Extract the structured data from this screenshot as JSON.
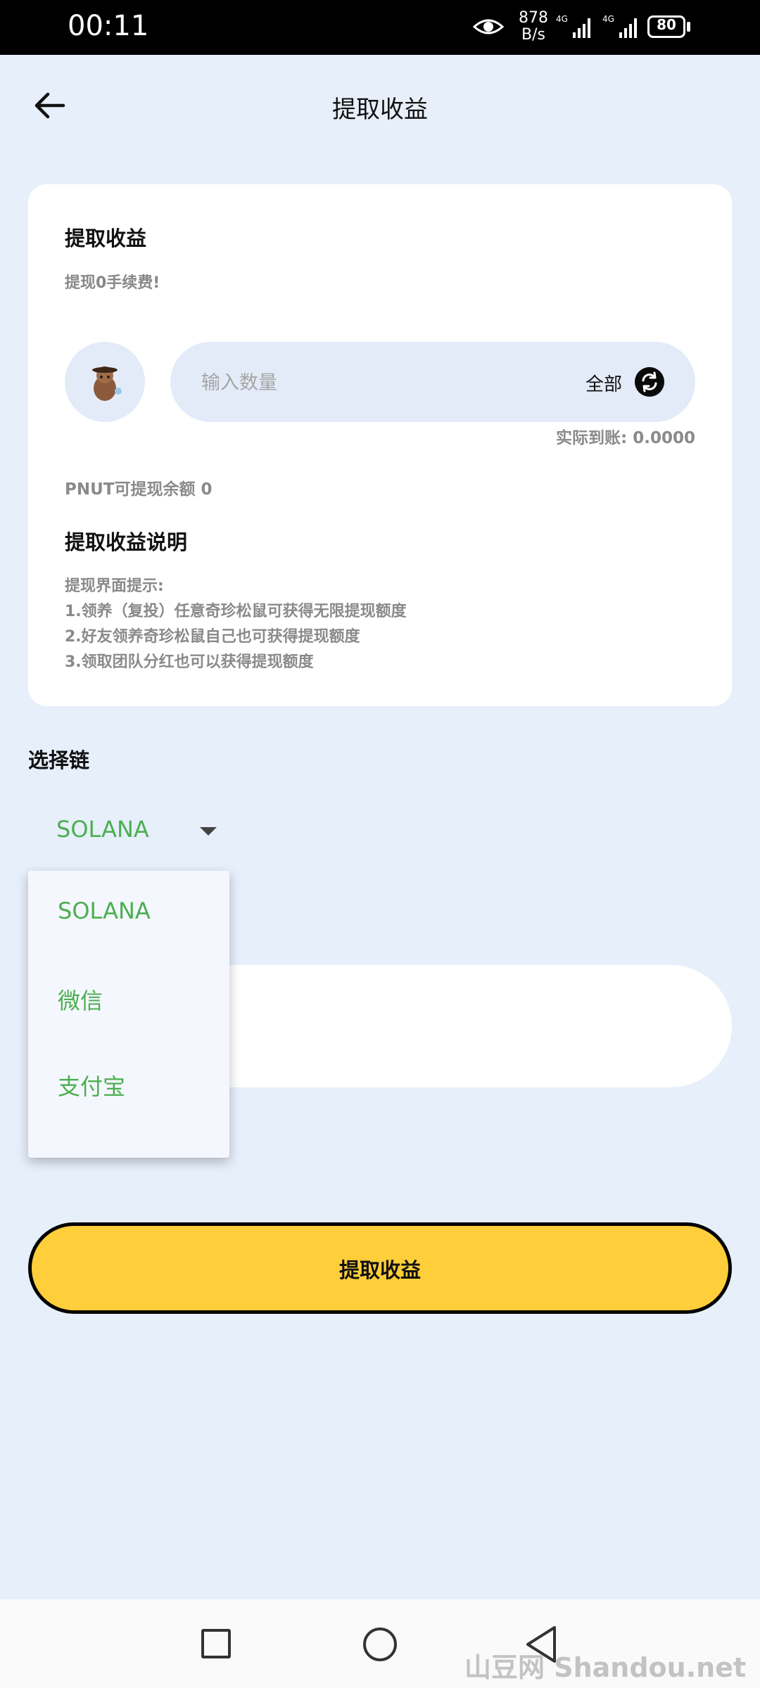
{
  "status_bar": {
    "time": "00:11",
    "net_speed_value": "878",
    "net_speed_unit": "B/s",
    "signal1_label": "4G",
    "signal2_label": "4G",
    "battery": "80"
  },
  "header": {
    "title": "提取收益"
  },
  "card": {
    "title": "提取收益",
    "fee_note": "提现0手续费!",
    "amount_placeholder": "输入数量",
    "all_label": "全部",
    "received": "实际到账: 0.0000",
    "balance": "PNUT可提现余额 0",
    "desc_title": "提取收益说明",
    "desc_lines": [
      "提现界面提示:",
      "1.领养（复投）任意奇珍松鼠可获得无限提现额度",
      "2.好友领养奇珍松鼠自己也可获得提现额度",
      "3.领取团队分红也可以获得提现额度"
    ]
  },
  "chain": {
    "label": "选择链",
    "selected": "SOLANA",
    "options": [
      "SOLANA",
      "微信",
      "支付宝"
    ]
  },
  "submit_label": "提取收益",
  "watermark": "山豆网 Shandou.net",
  "colors": {
    "background": "#E7EFFB",
    "accent_green": "#4CAF50",
    "button_yellow": "#FFCE3B"
  }
}
